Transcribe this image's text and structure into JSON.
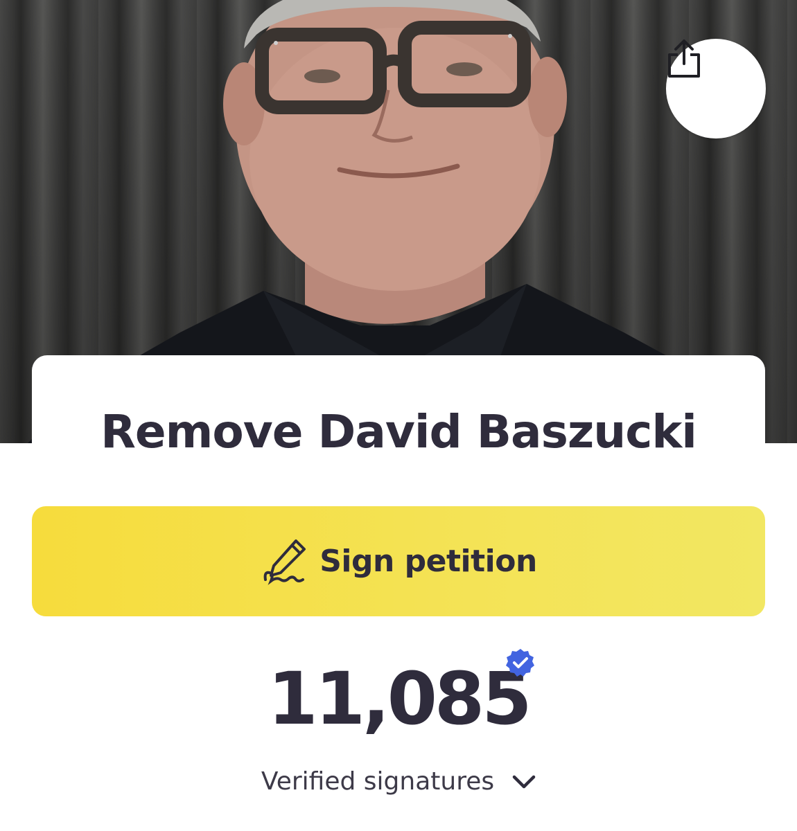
{
  "petition": {
    "title": "Remove David Baszucki"
  },
  "actions": {
    "share_icon": "share-icon",
    "sign_label": "Sign petition",
    "sign_icon": "pen-signature-icon"
  },
  "signatures": {
    "count": "11,085",
    "label": "Verified signatures",
    "badge_icon": "verified-badge-icon",
    "expand_icon": "chevron-down-icon"
  },
  "colors": {
    "sign_button": "#f4e04a",
    "text": "#2f2c3c",
    "verified_badge": "#4264e0"
  }
}
